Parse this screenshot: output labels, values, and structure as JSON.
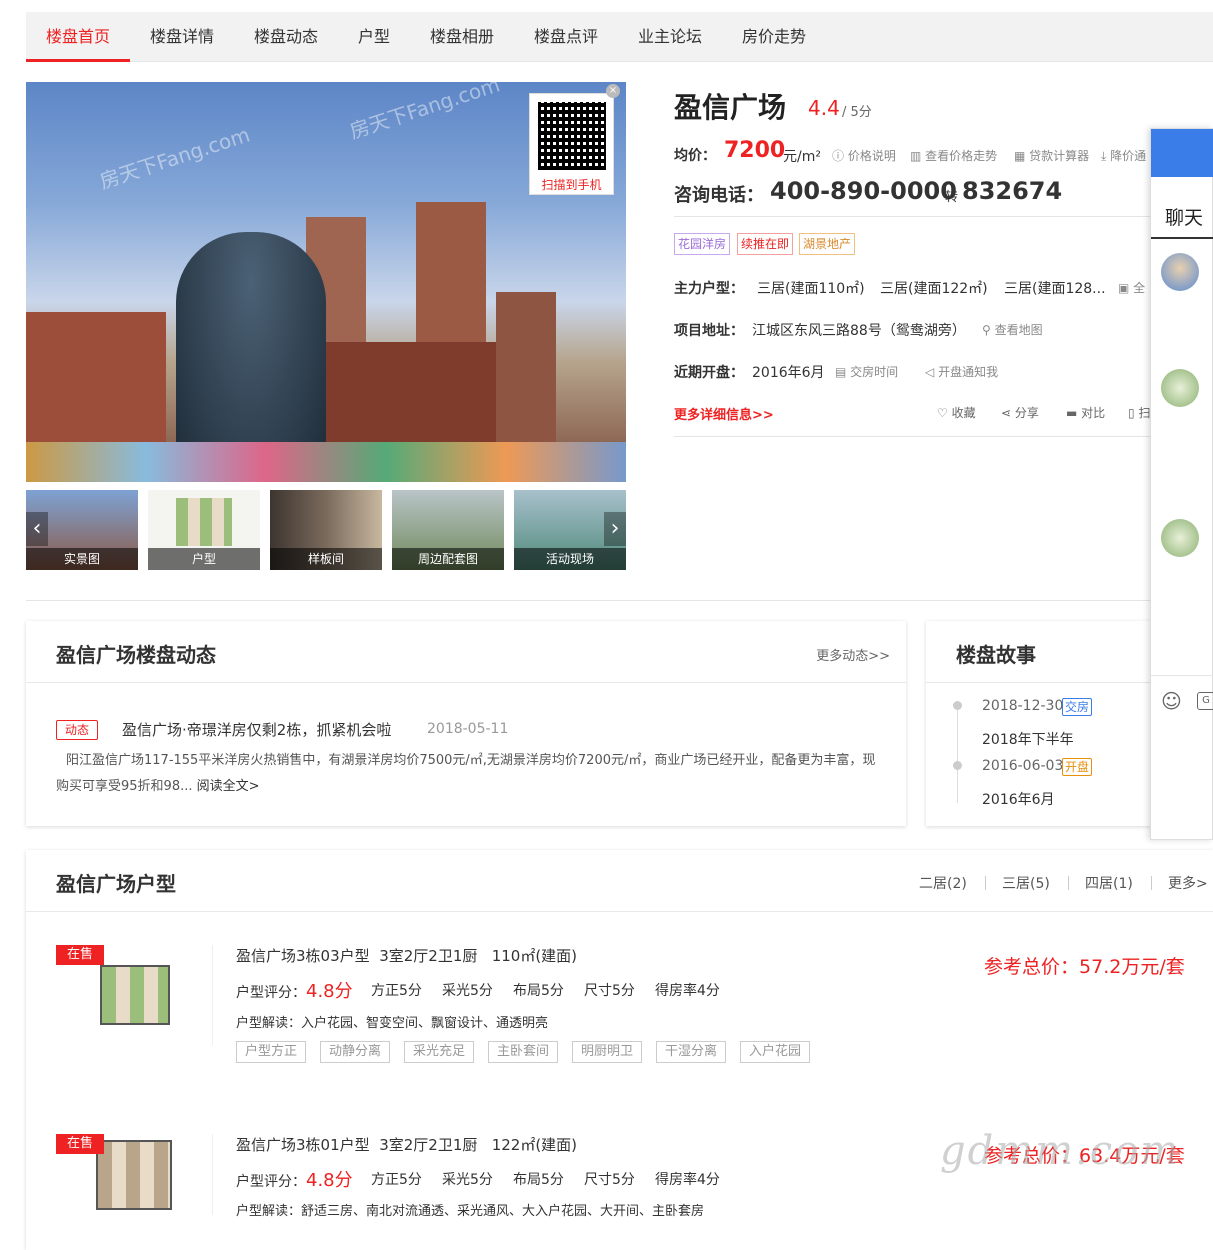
{
  "nav": {
    "items": [
      "楼盘首页",
      "楼盘详情",
      "楼盘动态",
      "户型",
      "楼盘相册",
      "楼盘点评",
      "业主论坛",
      "房价走势"
    ]
  },
  "gallery": {
    "watermark": "房天下Fang.com",
    "qr_label": "扫描到手机",
    "thumbs": [
      "实景图",
      "户型",
      "样板间",
      "周边配套图",
      "活动现场"
    ]
  },
  "info": {
    "name": "盈信广场",
    "score": "4.4",
    "score_max": "/ 5分",
    "price_label": "均价：",
    "price": "7200",
    "price_unit": "元/m²",
    "price_links": [
      "价格说明",
      "查看价格走势",
      "贷款计算器",
      "降价通"
    ],
    "phone_label": "咨询电话：",
    "phone": "400-890-0000",
    "phone_ext_label": "转",
    "phone_ext": "832674",
    "tags": [
      "花园洋房",
      "续推在即",
      "湖景地产"
    ],
    "layout_label": "主力户型：",
    "layouts": [
      "三居(建面110㎡)",
      "三居(建面122㎡)",
      "三居(建面128..."
    ],
    "layout_more": "全",
    "address_label": "项目地址：",
    "address": "江城区东风三路88号（鸳鸯湖旁）",
    "map_link": "查看地图",
    "open_label": "近期开盘：",
    "open_date": "2016年6月",
    "delivery_link": "交房时间",
    "notify_link": "开盘通知我",
    "more_link": "更多详细信息>>",
    "actions": [
      "收藏",
      "分享",
      "对比",
      "扫"
    ]
  },
  "news": {
    "title": "盈信广场楼盘动态",
    "more": "更多动态>>",
    "badge": "动态",
    "headline": "盈信广场·帝璟洋房仅剩2栋，抓紧机会啦",
    "date": "2018-05-11",
    "body": "阳江盈信广场117-155平米洋房火热销售中，有湖景洋房均价7500元/㎡,无湖景洋房均价7200元/㎡，商业广场已经开业，配备更为丰富，现购买可享受95折和98...",
    "read_more": "阅读全文>"
  },
  "story": {
    "title": "楼盘故事",
    "events": [
      {
        "date": "2018-12-30",
        "badge": "交房",
        "text": "2018年下半年"
      },
      {
        "date": "2016-06-03",
        "badge": "开盘",
        "text": "2016年6月"
      }
    ]
  },
  "layouts": {
    "title": "盈信广场户型",
    "filters": [
      "二居(2)",
      "三居(5)",
      "四居(1)",
      "更多>"
    ],
    "status": "在售",
    "price_label": "参考总价：",
    "items": [
      {
        "name": "盈信广场3栋03户型",
        "rooms": "3室2厅2卫1厨",
        "area": "110㎡(建面)",
        "rating_label": "户型评分：",
        "rating": "4.8分",
        "scores": [
          "方正5分",
          "采光5分",
          "布局5分",
          "尺寸5分",
          "得房率4分"
        ],
        "desc_label": "户型解读：",
        "desc": "入户花园、智变空间、飘窗设计、通透明亮",
        "price": "57.2万元/套",
        "pills": [
          "户型方正",
          "动静分离",
          "采光充足",
          "主卧套间",
          "明厨明卫",
          "干湿分离",
          "入户花园"
        ]
      },
      {
        "name": "盈信广场3栋01户型",
        "rooms": "3室2厅2卫1厨",
        "area": "122㎡(建面)",
        "rating_label": "户型评分：",
        "rating": "4.8分",
        "scores": [
          "方正5分",
          "采光5分",
          "布局5分",
          "尺寸5分",
          "得房率4分"
        ],
        "desc_label": "户型解读：",
        "desc": "舒适三房、南北对流通透、采光通风、大入户花园、大开间、主卧套房",
        "price": "63.4万元/套"
      }
    ]
  },
  "chat": {
    "title": "聊天"
  },
  "watermark": "gdmm.com",
  "colors": {
    "accent": "#e22222",
    "chat_blue": "#3b7de8"
  }
}
